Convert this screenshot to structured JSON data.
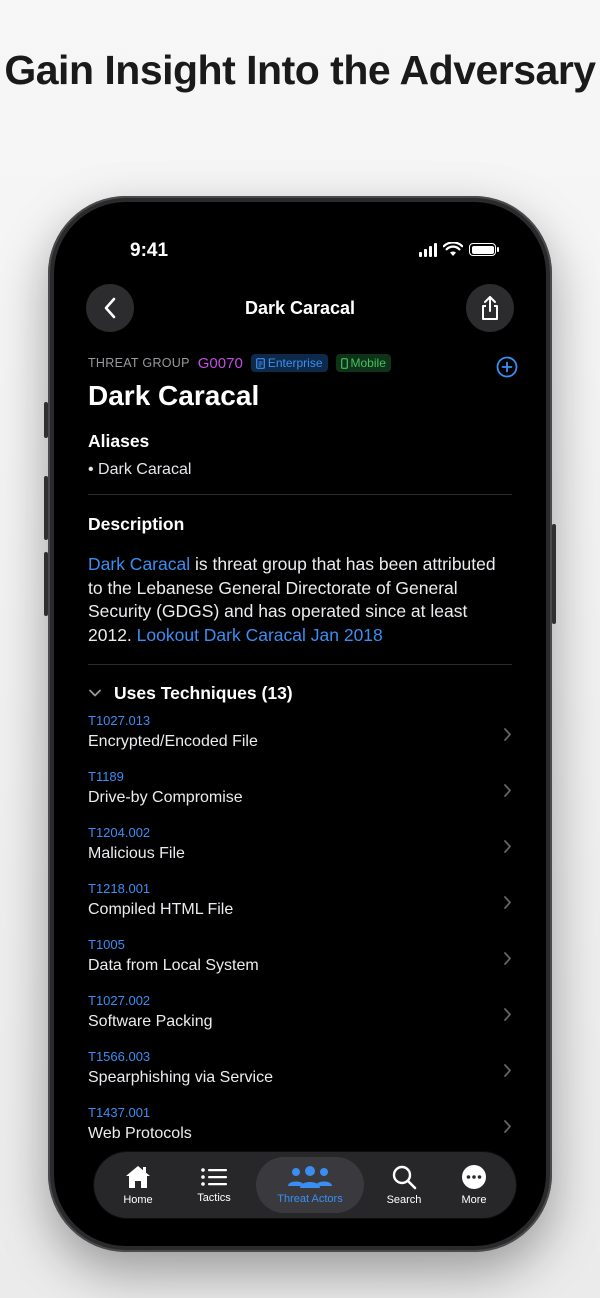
{
  "headline": "Gain Insight Into the Adversary",
  "status_bar": {
    "time": "9:41"
  },
  "nav": {
    "title": "Dark Caracal"
  },
  "group": {
    "type_label": "THREAT GROUP",
    "id": "G0070",
    "tags": [
      "Enterprise",
      "Mobile"
    ],
    "name": "Dark Caracal"
  },
  "aliases": {
    "heading": "Aliases",
    "items": [
      "Dark Caracal"
    ]
  },
  "description": {
    "heading": "Description",
    "link_name": "Dark Caracal",
    "text": " is threat group that has been attributed to the Lebanese General Directorate of General Security (GDGS) and has operated since at least 2012. ",
    "ref_link": "Lookout Dark Caracal Jan 2018"
  },
  "techniques": {
    "heading": "Uses Techniques (13)",
    "items": [
      {
        "id": "T1027.013",
        "name": "Encrypted/Encoded File"
      },
      {
        "id": "T1189",
        "name": "Drive-by Compromise"
      },
      {
        "id": "T1204.002",
        "name": "Malicious File"
      },
      {
        "id": "T1218.001",
        "name": "Compiled HTML File"
      },
      {
        "id": "T1005",
        "name": "Data from Local System"
      },
      {
        "id": "T1027.002",
        "name": "Software Packing"
      },
      {
        "id": "T1566.003",
        "name": "Spearphishing via Service"
      },
      {
        "id": "T1437.001",
        "name": "Web Protocols"
      }
    ]
  },
  "tabbar": {
    "items": [
      "Home",
      "Tactics",
      "Threat Actors",
      "Search",
      "More"
    ],
    "active": "Threat Actors"
  },
  "colors": {
    "accent": "#3a8ef2",
    "group_id": "#c34fe0",
    "mobile": "#43c25d"
  }
}
